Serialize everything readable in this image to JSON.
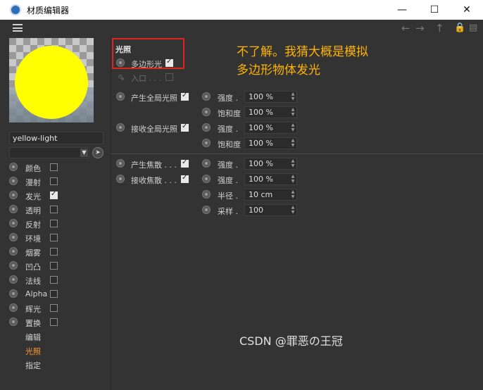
{
  "window": {
    "title": "材质编辑器"
  },
  "material": {
    "name": "yellow-light",
    "dropdown_value": ""
  },
  "channels": [
    {
      "label": "颜色",
      "checked": false
    },
    {
      "label": "漫射",
      "checked": false
    },
    {
      "label": "发光",
      "checked": true
    },
    {
      "label": "透明",
      "checked": false
    },
    {
      "label": "反射",
      "checked": false
    },
    {
      "label": "环境",
      "checked": false
    },
    {
      "label": "烟雾",
      "checked": false
    },
    {
      "label": "凹凸",
      "checked": false
    },
    {
      "label": "法线",
      "checked": false
    },
    {
      "label": "Alpha",
      "checked": false
    },
    {
      "label": "辉光",
      "checked": false
    },
    {
      "label": "置换",
      "checked": false
    }
  ],
  "tabs": [
    {
      "label": "编辑",
      "active": false
    },
    {
      "label": "光照",
      "active": true
    },
    {
      "label": "指定",
      "active": false
    }
  ],
  "lighting": {
    "group_title": "光照",
    "polygon_light": {
      "label": "多边形光",
      "checked": true
    },
    "portal": {
      "label": "入口 . . .",
      "checked": false
    },
    "gi_generate": {
      "label": "产生全局光照",
      "checked": true
    },
    "gi_receive": {
      "label": "接收全局光照",
      "checked": true
    },
    "caustics_generate": {
      "label": "产生焦散 . . .",
      "checked": true
    },
    "caustics_receive": {
      "label": "接收焦散 . . .",
      "checked": true
    },
    "params": [
      {
        "label": "强度 .",
        "value": "100 %"
      },
      {
        "label": "饱和度",
        "value": "100 %"
      },
      {
        "label": "强度 .",
        "value": "100 %"
      },
      {
        "label": "饱和度",
        "value": "100 %"
      },
      {
        "label": "强度 .",
        "value": "100 %"
      },
      {
        "label": "强度 .",
        "value": "100 %"
      },
      {
        "label": "半径 .",
        "value": "10 cm"
      },
      {
        "label": "采样 .",
        "value": "100"
      }
    ]
  },
  "annotation": "不了解。我猜大概是模拟多边形物体发光",
  "watermark": "CSDN @罪恶の王冠",
  "colors": {
    "accent_tab": "#ff9933",
    "annotation": "#ffb300",
    "highlight_box": "#e0231c",
    "preview_sphere": "#ffff00"
  },
  "icons": [
    "menu-icon",
    "back-arrow-icon",
    "forward-arrow-icon",
    "up-arrow-icon",
    "lock-icon",
    "new-window-icon",
    "picker-icon",
    "app-icon"
  ]
}
